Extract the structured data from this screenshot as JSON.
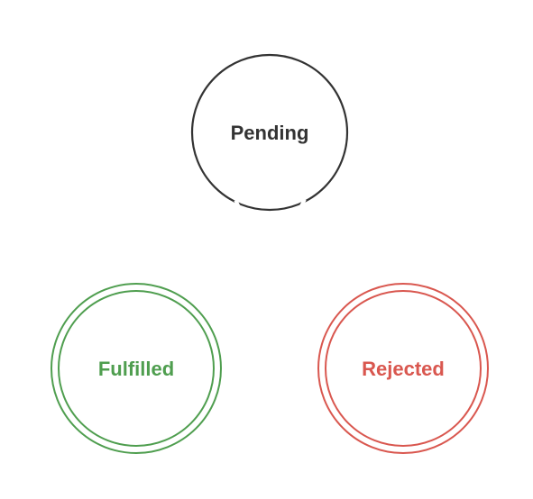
{
  "diagram": {
    "states": [
      {
        "id": "pending",
        "label": "Pending",
        "color": "#333333",
        "double_border": false
      },
      {
        "id": "fulfilled",
        "label": "Fulfilled",
        "color": "#4f9e4f",
        "double_border": true
      },
      {
        "id": "rejected",
        "label": "Rejected",
        "color": "#d9574f",
        "double_border": true
      }
    ]
  }
}
